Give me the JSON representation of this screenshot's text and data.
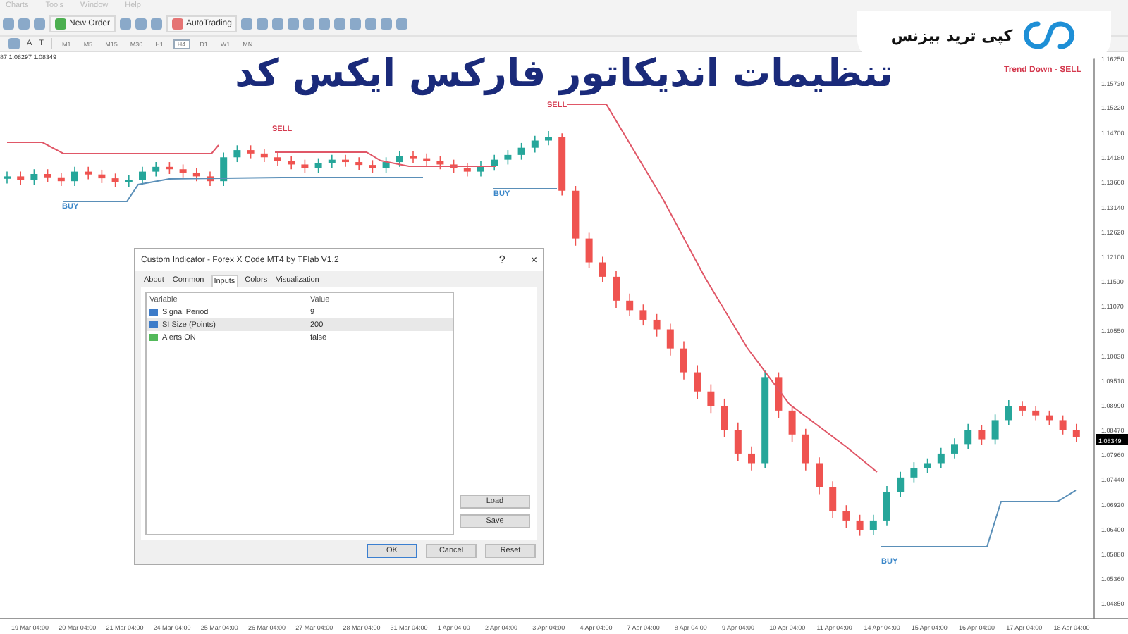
{
  "menu": [
    {
      "label": "Charts"
    },
    {
      "label": "Tools"
    },
    {
      "label": "Window"
    },
    {
      "label": "Help"
    }
  ],
  "toolbar": {
    "new_order": "New Order",
    "auto_trading": "AutoTrading"
  },
  "toolbar2": {
    "text_tools": [
      "A",
      "T"
    ],
    "timeframes": [
      {
        "label": "M1",
        "selected": false
      },
      {
        "label": "M5",
        "selected": false
      },
      {
        "label": "M15",
        "selected": false
      },
      {
        "label": "M30",
        "selected": false
      },
      {
        "label": "H1",
        "selected": false
      },
      {
        "label": "H4",
        "selected": true
      },
      {
        "label": "D1",
        "selected": false
      },
      {
        "label": "W1",
        "selected": false
      },
      {
        "label": "MN",
        "selected": false
      }
    ]
  },
  "overlay": {
    "title": "تنظیمات اندیکاتور فارکس ایکس کد",
    "brand": "کپی ترید بیزنس"
  },
  "chart": {
    "info": "87 1.08297 1.08349",
    "trend": "Trend Down - SELL",
    "current_price": "1.08349",
    "signals": [
      {
        "kind": "sell",
        "label": "SELL"
      },
      {
        "kind": "sell",
        "label": "SELL"
      },
      {
        "kind": "buy",
        "label": "BUY"
      },
      {
        "kind": "buy",
        "label": "BUY"
      },
      {
        "kind": "buy",
        "label": "BUY"
      }
    ],
    "time_labels": [
      "19 Mar 04:00",
      "20 Mar 04:00",
      "21 Mar 04:00",
      "24 Mar 04:00",
      "25 Mar 04:00",
      "26 Mar 04:00",
      "27 Mar 04:00",
      "28 Mar 04:00",
      "31 Mar 04:00",
      "1 Apr 04:00",
      "2 Apr 04:00",
      "3 Apr 04:00",
      "4 Apr 04:00",
      "7 Apr 04:00",
      "8 Apr 04:00",
      "9 Apr 04:00",
      "10 Apr 04:00",
      "11 Apr 04:00",
      "14 Apr 04:00",
      "15 Apr 04:00",
      "16 Apr 04:00",
      "17 Apr 04:00",
      "18 Apr 04:00"
    ],
    "chart_data": {
      "type": "candlestick",
      "ylim": [
        1.0455,
        1.164
      ],
      "ohlc": [
        [
          1.1375,
          1.139,
          1.1365,
          1.138
        ],
        [
          1.138,
          1.139,
          1.1362,
          1.1372
        ],
        [
          1.1372,
          1.1395,
          1.1362,
          1.1385
        ],
        [
          1.1385,
          1.1395,
          1.1368,
          1.1378
        ],
        [
          1.1378,
          1.1388,
          1.136,
          1.137
        ],
        [
          1.137,
          1.14,
          1.136,
          1.139
        ],
        [
          1.139,
          1.14,
          1.1374,
          1.1384
        ],
        [
          1.1384,
          1.1394,
          1.1366,
          1.1376
        ],
        [
          1.1376,
          1.1386,
          1.1358,
          1.1368
        ],
        [
          1.1368,
          1.1382,
          1.1358,
          1.1372
        ],
        [
          1.1372,
          1.14,
          1.1362,
          1.139
        ],
        [
          1.139,
          1.141,
          1.138,
          1.14
        ],
        [
          1.14,
          1.141,
          1.1385,
          1.1395
        ],
        [
          1.1395,
          1.1405,
          1.1378,
          1.1388
        ],
        [
          1.1388,
          1.1398,
          1.137,
          1.138
        ],
        [
          1.138,
          1.139,
          1.136,
          1.137
        ],
        [
          1.137,
          1.143,
          1.136,
          1.142
        ],
        [
          1.142,
          1.1445,
          1.141,
          1.1435
        ],
        [
          1.1435,
          1.1445,
          1.1418,
          1.1428
        ],
        [
          1.1428,
          1.1438,
          1.141,
          1.142
        ],
        [
          1.142,
          1.143,
          1.1402,
          1.1412
        ],
        [
          1.1412,
          1.1422,
          1.1395,
          1.1405
        ],
        [
          1.1405,
          1.1415,
          1.1388,
          1.1398
        ],
        [
          1.1398,
          1.1418,
          1.1388,
          1.1408
        ],
        [
          1.1408,
          1.1425,
          1.1398,
          1.1415
        ],
        [
          1.1415,
          1.1425,
          1.14,
          1.141
        ],
        [
          1.141,
          1.142,
          1.1394,
          1.1404
        ],
        [
          1.1404,
          1.1414,
          1.1388,
          1.1398
        ],
        [
          1.1398,
          1.142,
          1.1388,
          1.141
        ],
        [
          1.141,
          1.1432,
          1.14,
          1.1422
        ],
        [
          1.1422,
          1.1432,
          1.1408,
          1.1418
        ],
        [
          1.1418,
          1.1428,
          1.1402,
          1.1412
        ],
        [
          1.1412,
          1.1422,
          1.1395,
          1.1405
        ],
        [
          1.1405,
          1.1415,
          1.1388,
          1.1398
        ],
        [
          1.1398,
          1.1408,
          1.138,
          1.139
        ],
        [
          1.139,
          1.1412,
          1.138,
          1.1402
        ],
        [
          1.1402,
          1.1425,
          1.1392,
          1.1415
        ],
        [
          1.1415,
          1.1435,
          1.1405,
          1.1425
        ],
        [
          1.1425,
          1.145,
          1.1415,
          1.144
        ],
        [
          1.144,
          1.1465,
          1.143,
          1.1455
        ],
        [
          1.1455,
          1.1475,
          1.1445,
          1.1462
        ],
        [
          1.1462,
          1.147,
          1.134,
          1.135
        ],
        [
          1.135,
          1.136,
          1.1235,
          1.125
        ],
        [
          1.125,
          1.1262,
          1.1188,
          1.12
        ],
        [
          1.12,
          1.1212,
          1.1158,
          1.117
        ],
        [
          1.117,
          1.1182,
          1.1105,
          1.112
        ],
        [
          1.112,
          1.1135,
          1.1088,
          1.11
        ],
        [
          1.11,
          1.1112,
          1.1068,
          1.108
        ],
        [
          1.108,
          1.1092,
          1.1045,
          1.106
        ],
        [
          1.106,
          1.1072,
          1.1005,
          1.102
        ],
        [
          1.102,
          1.1035,
          1.0955,
          1.097
        ],
        [
          1.097,
          1.0985,
          1.0915,
          1.093
        ],
        [
          1.093,
          1.0945,
          1.0885,
          1.09
        ],
        [
          1.09,
          1.0915,
          1.0835,
          1.085
        ],
        [
          1.085,
          1.0865,
          1.0785,
          1.08
        ],
        [
          1.08,
          1.0815,
          1.0765,
          1.078
        ],
        [
          1.078,
          1.0975,
          1.077,
          1.096
        ],
        [
          1.096,
          1.097,
          1.0875,
          1.089
        ],
        [
          1.089,
          1.09,
          1.0825,
          1.084
        ],
        [
          1.084,
          1.0852,
          1.0765,
          1.078
        ],
        [
          1.078,
          1.0792,
          1.0715,
          1.073
        ],
        [
          1.073,
          1.0742,
          1.0665,
          1.068
        ],
        [
          1.068,
          1.0692,
          1.0645,
          1.066
        ],
        [
          1.066,
          1.0672,
          1.0628,
          1.064
        ],
        [
          1.064,
          1.0672,
          1.063,
          1.066
        ],
        [
          1.066,
          1.0732,
          1.065,
          1.072
        ],
        [
          1.072,
          1.0762,
          1.071,
          1.075
        ],
        [
          1.075,
          1.0782,
          1.074,
          1.077
        ],
        [
          1.077,
          1.079,
          1.076,
          1.078
        ],
        [
          1.078,
          1.0812,
          1.077,
          1.08
        ],
        [
          1.08,
          1.0832,
          1.079,
          1.082
        ],
        [
          1.082,
          1.0862,
          1.081,
          1.085
        ],
        [
          1.085,
          1.086,
          1.0818,
          1.083
        ],
        [
          1.083,
          1.0882,
          1.082,
          1.087
        ],
        [
          1.087,
          1.0912,
          1.086,
          1.09
        ],
        [
          1.09,
          1.091,
          1.0878,
          1.089
        ],
        [
          1.089,
          1.09,
          1.087,
          1.088
        ],
        [
          1.088,
          1.089,
          1.086,
          1.087
        ],
        [
          1.087,
          1.088,
          1.084,
          1.085
        ],
        [
          1.085,
          1.0862,
          1.0825,
          1.0835
        ]
      ],
      "yticks": [
        {
          "value": 1.1625,
          "label": "1.16250"
        },
        {
          "value": 1.1573,
          "label": "1.15730"
        },
        {
          "value": 1.1522,
          "label": "1.15220"
        },
        {
          "value": 1.147,
          "label": "1.14700"
        },
        {
          "value": 1.1418,
          "label": "1.14180"
        },
        {
          "value": 1.1366,
          "label": "1.13660"
        },
        {
          "value": 1.1314,
          "label": "1.13140"
        },
        {
          "value": 1.1262,
          "label": "1.12620"
        },
        {
          "value": 1.121,
          "label": "1.12100"
        },
        {
          "value": 1.1159,
          "label": "1.11590"
        },
        {
          "value": 1.1107,
          "label": "1.11070"
        },
        {
          "value": 1.1055,
          "label": "1.10550"
        },
        {
          "value": 1.1003,
          "label": "1.10030"
        },
        {
          "value": 1.0951,
          "label": "1.09510"
        },
        {
          "value": 1.0899,
          "label": "1.08990"
        },
        {
          "value": 1.0847,
          "label": "1.08470"
        },
        {
          "value": 1.0796,
          "label": "1.07960"
        },
        {
          "value": 1.0744,
          "label": "1.07440"
        },
        {
          "value": 1.0692,
          "label": "1.06920"
        },
        {
          "value": 1.064,
          "label": "1.06400"
        },
        {
          "value": 1.0588,
          "label": "1.05880"
        },
        {
          "value": 1.0536,
          "label": "1.05360"
        },
        {
          "value": 1.0485,
          "label": "1.04850"
        }
      ]
    }
  },
  "dialog": {
    "title": "Custom Indicator - Forex X Code MT4 by TFlab V1.2",
    "help": "?",
    "close": "×",
    "tabs": [
      {
        "label": "About",
        "selected": false
      },
      {
        "label": "Common",
        "selected": false
      },
      {
        "label": "Inputs",
        "selected": true
      },
      {
        "label": "Colors",
        "selected": false
      },
      {
        "label": "Visualization",
        "selected": false
      }
    ],
    "columns": [
      "Variable",
      "Value"
    ],
    "rows": [
      {
        "kind": "number",
        "variable": "Signal Period",
        "value": "9",
        "selected": false
      },
      {
        "kind": "number",
        "variable": "SI Size (Points)",
        "value": "200",
        "selected": true
      },
      {
        "kind": "bool",
        "variable": "Alerts ON",
        "value": "false",
        "selected": false
      }
    ],
    "side_buttons": [
      "Load",
      "Save"
    ],
    "buttons": [
      "OK",
      "Cancel",
      "Reset"
    ]
  }
}
